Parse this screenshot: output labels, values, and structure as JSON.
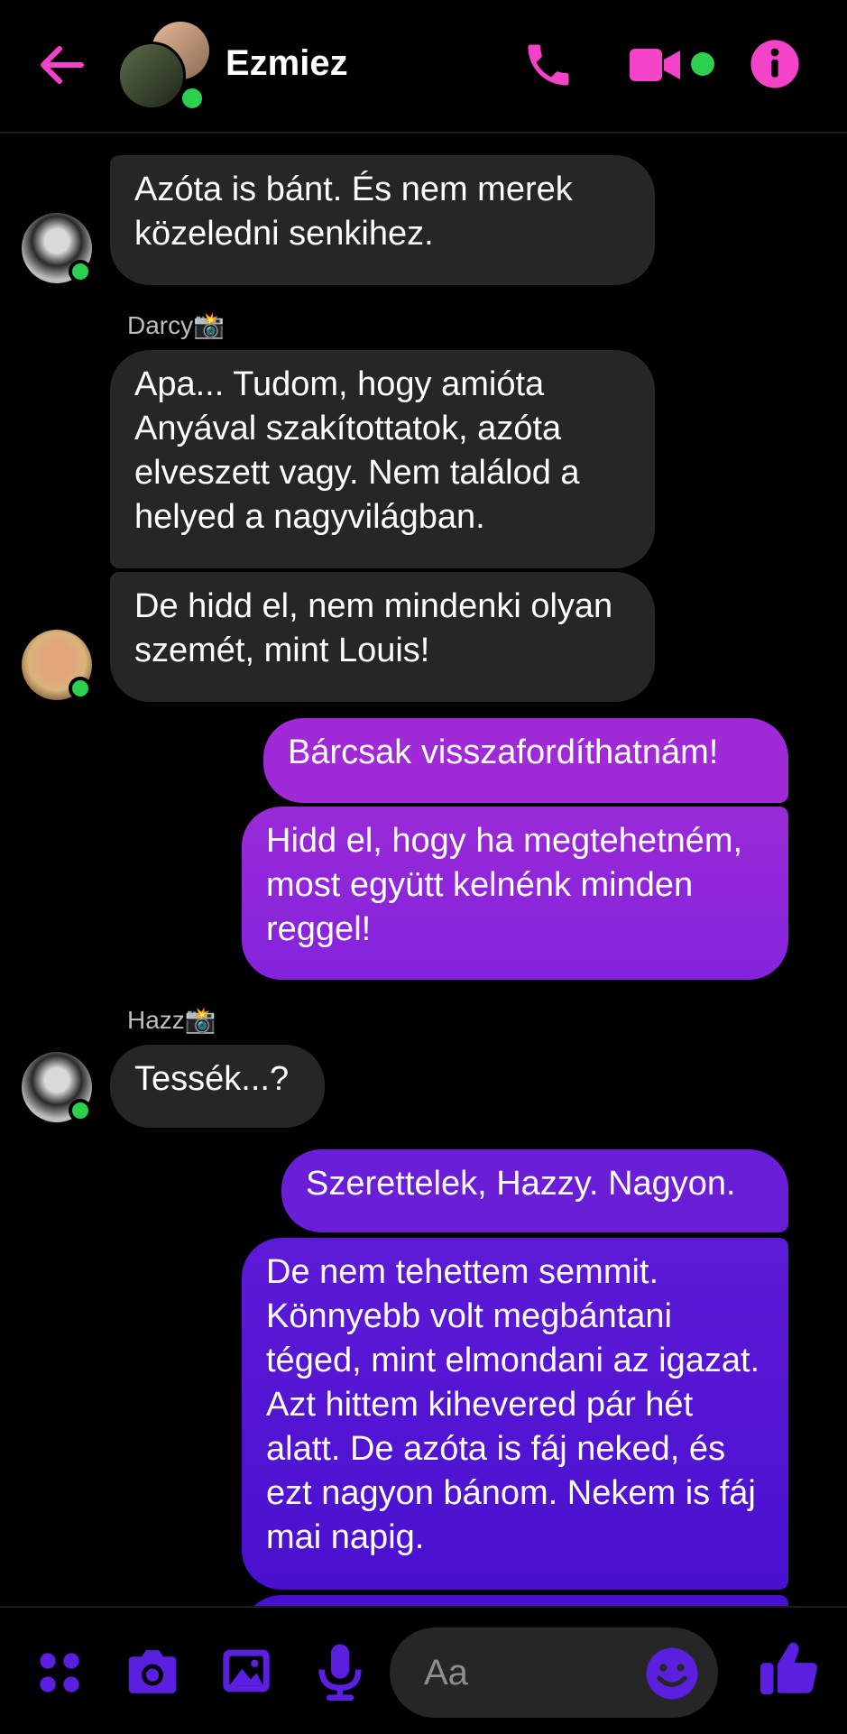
{
  "header": {
    "title": "Ezmiez",
    "accent_color": "#f442c9",
    "icons": [
      "back-arrow-icon",
      "phone-icon",
      "video-camera-icon",
      "info-icon"
    ]
  },
  "chat": {
    "messages": [
      {
        "side": "in",
        "text": "Azóta is bánt. És nem merek közeledni senkihez."
      },
      {
        "side": "in",
        "sender": "Darcy📸",
        "text": "Apa... Tudom, hogy amióta Anyával szakítottatok, azóta elveszett vagy. Nem találod a helyed a nagyvilágban."
      },
      {
        "side": "in",
        "text": "De hidd el, nem mindenki olyan szemét, mint Louis!"
      },
      {
        "side": "out",
        "text": "Bárcsak visszafordíthatnám!"
      },
      {
        "side": "out",
        "text": "Hidd el, hogy ha megtehetném, most együtt kelnénk minden reggel!"
      },
      {
        "side": "in",
        "sender": "Hazz📸",
        "text": "Tessék...?"
      },
      {
        "side": "out",
        "text": "Szerettelek, Hazzy. Nagyon."
      },
      {
        "side": "out",
        "text": "De nem tehettem semmit. Könnyebb volt megbántani téged, mint elmondani az igazat. Azt hittem kihevered pár hét alatt. De azóta is fáj neked, és ezt nagyon bánom. Nekem is fáj mai napig."
      }
    ],
    "outgoing_gradient": [
      "#a52bdc",
      "#4a10d0"
    ],
    "incoming_color": "#262626",
    "online_color": "#2bd04f"
  },
  "footer": {
    "placeholder": "Aa",
    "icon_color": "#5b1fe0",
    "icons": [
      "menu-dots-icon",
      "camera-icon",
      "gallery-icon",
      "microphone-icon",
      "emoji-icon",
      "thumbs-up-icon"
    ]
  }
}
